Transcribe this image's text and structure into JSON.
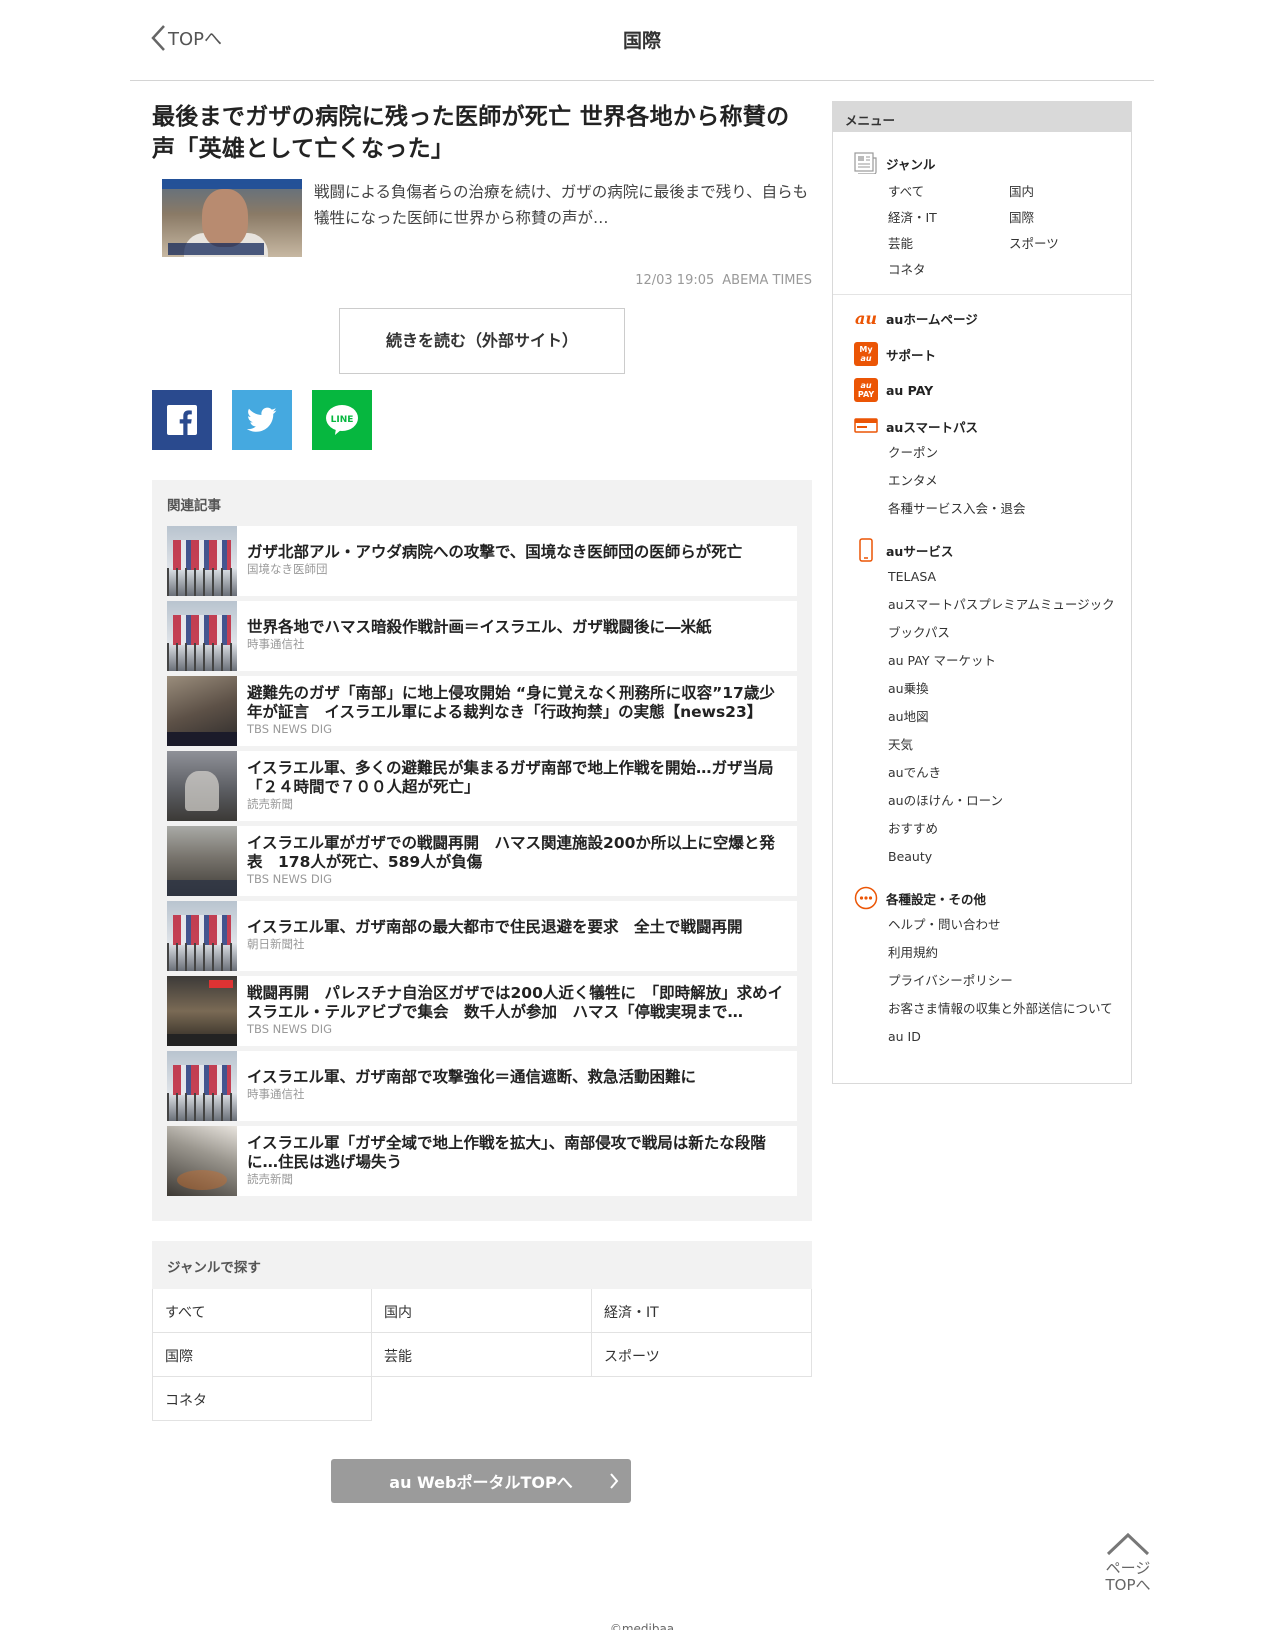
{
  "header": {
    "back_label": "TOPへ",
    "title": "国際"
  },
  "article": {
    "headline": "最後までガザの病院に残った医師が死亡 世界各地から称賛の声「英雄として亡くなった」",
    "summary": "戦闘による負傷者らの治療を続け、ガザの病院に最後まで残り、自らも犠牲になった医師に世界から称賛の声が…",
    "date": "12/03 19:05",
    "source": "ABEMA TIMES",
    "read_more": "続きを読む（外部サイト）"
  },
  "share": {
    "facebook": "facebook-share",
    "twitter": "twitter-share",
    "line": "LINE"
  },
  "related": {
    "label": "関連記事",
    "items": [
      {
        "title": "ガザ北部アル・アウダ病院への攻撃で、国境なき医師団の医師らが死亡",
        "source": "国境なき医師団",
        "thumb": "flags"
      },
      {
        "title": "世界各地でハマス暗殺作戦計画＝イスラエル、ガザ戦闘後に―米紙",
        "source": "時事通信社",
        "thumb": "flags"
      },
      {
        "title": "避難先のガザ「南部」に地上侵攻開始 “身に覚えなく刑務所に収容”17歳少年が証言　イスラエル軍による裁判なき「行政拘禁」の実態【news23】",
        "source": "TBS NEWS DIG",
        "thumb": "crowd"
      },
      {
        "title": "イスラエル軍、多くの避難民が集まるガザ南部で地上作戦を開始…ガザ当局「２４時間で７００人超が死亡」",
        "source": "読売新聞",
        "thumb": "street"
      },
      {
        "title": "イスラエル軍がガザでの戦闘再開　ハマス関連施設200か所以上に空爆と発表　178人が死亡、589人が負傷",
        "source": "TBS NEWS DIG",
        "thumb": "rubble"
      },
      {
        "title": "イスラエル軍、ガザ南部の最大都市で住民退避を要求　全土で戦闘再開",
        "source": "朝日新聞社",
        "thumb": "flags"
      },
      {
        "title": "戦闘再開　パレスチナ自治区ガザでは200人近く犠牲に　「即時解放」求めイスラエル・テルアビブで集会　数千人が参加　ハマス「停戦実現まで…",
        "source": "TBS NEWS DIG",
        "thumb": "night"
      },
      {
        "title": "イスラエル軍、ガザ南部で攻撃強化＝通信遮断、救急活動困難に",
        "source": "時事通信社",
        "thumb": "flags"
      },
      {
        "title": "イスラエル軍「ガザ全域で地上作戦を拡大」、南部侵攻で戦局は新たな段階に…住民は逃げ場失う",
        "source": "読売新聞",
        "thumb": "smoke"
      }
    ]
  },
  "genre": {
    "label": "ジャンルで探す",
    "items": [
      "すべて",
      "国内",
      "経済・IT",
      "国際",
      "芸能",
      "スポーツ",
      "コネタ"
    ]
  },
  "portal_button": "au WebポータルTOPへ",
  "sidebar": {
    "head": "メニュー",
    "genre_title": "ジャンル",
    "genre_items": [
      "すべて",
      "国内",
      "経済・IT",
      "国際",
      "芸能",
      "スポーツ",
      "コネタ"
    ],
    "au_home": "auホームページ",
    "support": "サポート",
    "au_pay": "au PAY",
    "smartpass": "auスマートパス",
    "smartpass_links": [
      "クーポン",
      "エンタメ",
      "各種サービス入会・退会"
    ],
    "au_services": "auサービス",
    "service_links": [
      "TELASA",
      "auスマートパスプレミアムミュージック",
      "ブックパス",
      "au PAY マーケット",
      "au乗換",
      "au地図",
      "天気",
      "auでんき",
      "auのほけん・ローン",
      "おすすめ",
      "Beauty"
    ],
    "settings": "各種設定・その他",
    "settings_links": [
      "ヘルプ・問い合わせ",
      "利用規約",
      "プライバシーポリシー",
      "お客さま情報の収集と外部送信について",
      "au ID"
    ],
    "icon_labels": {
      "au_logo": "au",
      "my_au": "My",
      "my_au_sub": "au",
      "pay_top": "au",
      "pay_bottom": "PAY"
    }
  },
  "pagetop": {
    "line1": "ページ",
    "line2": "TOPへ"
  },
  "footer": {
    "copyright": "©medibaa"
  },
  "colors": {
    "facebook": "#2a4a8e",
    "twitter": "#45a9e0",
    "line": "#06b73f",
    "au_orange": "#eb5505",
    "button_gray": "#9b9b9b"
  }
}
